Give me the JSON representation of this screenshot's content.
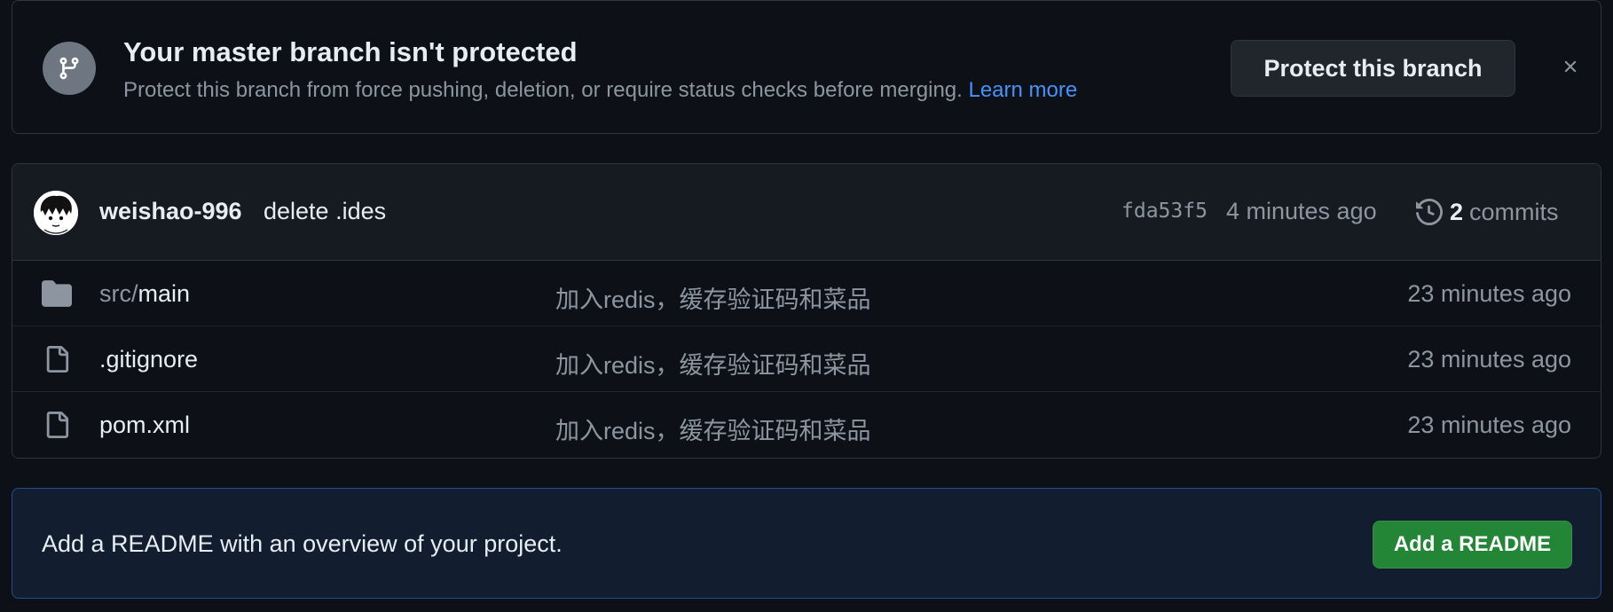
{
  "banner": {
    "title": "Your master branch isn't protected",
    "description": "Protect this branch from force pushing, deletion, or require status checks before merging.",
    "learn_more": "Learn more",
    "protect_button": "Protect this branch",
    "close_icon": "close-icon",
    "badge_icon": "git-branch-icon"
  },
  "latest_commit": {
    "author": "weishao-996",
    "message": "delete .ides",
    "hash": "fda53f5",
    "time": "4 minutes ago",
    "commit_count": "2",
    "commits_label": "commits",
    "history_icon": "history-icon"
  },
  "files": [
    {
      "prefix": "src/",
      "name": "main",
      "type": "folder",
      "icon": "folder-icon",
      "commit_message": "加入redis，缓存验证码和菜品",
      "time": "23 minutes ago"
    },
    {
      "prefix": "",
      "name": ".gitignore",
      "type": "file",
      "icon": "file-icon",
      "commit_message": "加入redis，缓存验证码和菜品",
      "time": "23 minutes ago"
    },
    {
      "prefix": "",
      "name": "pom.xml",
      "type": "file",
      "icon": "file-icon",
      "commit_message": "加入redis，缓存验证码和菜品",
      "time": "23 minutes ago"
    }
  ],
  "readme": {
    "text": "Add a README with an overview of your project.",
    "button": "Add a README"
  },
  "colors": {
    "background": "#0d1117",
    "link": "#4493f8",
    "primary_button": "#238636",
    "muted_text": "#8d96a0"
  }
}
